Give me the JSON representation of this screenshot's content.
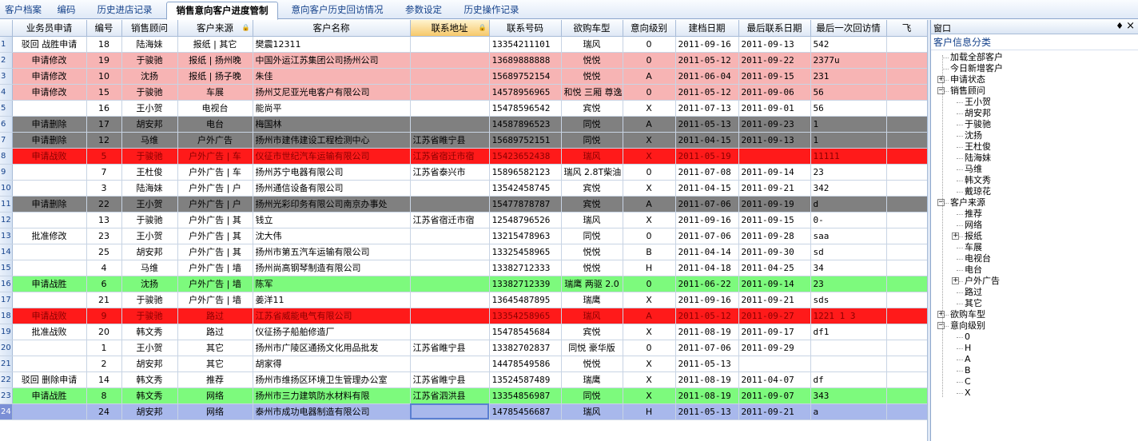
{
  "tabs": [
    "客户档案",
    "编码",
    "历史进店记录",
    "销售意向客户进度管制",
    "意向客户历史回访情况",
    "参数设定",
    "历史操作记录"
  ],
  "active_tab": 3,
  "table": {
    "headers": [
      "业务员申请",
      "编号",
      "销售顾问",
      "客户来源",
      "客户名称",
      "联系地址",
      "联系号码",
      "欲购车型",
      "意向级别",
      "建档日期",
      "最后联系日期",
      "最后一次回访情",
      "飞"
    ],
    "sorted_col": 5,
    "lock_icons": {
      "3": "lock-icon",
      "5": "lock-icon"
    },
    "rows": [
      {
        "rn": "1",
        "style": "normal",
        "cells": [
          "驳回 战胜申请",
          "18",
          "陆海妹",
          "报纸 | 其它",
          "樊震12311",
          "",
          "13354211101",
          "瑞风",
          "0",
          "2011-09-16",
          "2011-09-13",
          "542",
          ""
        ]
      },
      {
        "rn": "2",
        "style": "pink",
        "cells": [
          "申请修改",
          "19",
          "于骏驰",
          "报纸 | 扬州晚",
          "中国外运江苏集团公司扬州公司",
          "",
          "13689888888",
          "悦悦",
          "0",
          "2011-05-12",
          "2011-09-22",
          "2377u",
          ""
        ]
      },
      {
        "rn": "3",
        "style": "pink",
        "cells": [
          "申请修改",
          "10",
          "沈扬",
          "报纸 | 扬子晚",
          "朱佳",
          "",
          "15689752154",
          "悦悦",
          "A",
          "2011-06-04",
          "2011-09-15",
          "231",
          ""
        ]
      },
      {
        "rn": "4",
        "style": "pink",
        "cells": [
          "申请修改",
          "15",
          "于骏驰",
          "车展",
          "扬州艾尼亚光电客户有限公司",
          "",
          "14578956965",
          "和悦 三厢 尊逸版",
          "0",
          "2011-05-12",
          "2011-09-06",
          "56",
          ""
        ]
      },
      {
        "rn": "5",
        "style": "normal",
        "cells": [
          "",
          "16",
          "王小贺",
          "电视台",
          "能尚平",
          "",
          "15478596542",
          "宾悦",
          "X",
          "2011-07-13",
          "2011-09-01",
          "56",
          ""
        ]
      },
      {
        "rn": "6",
        "style": "gray",
        "cells": [
          "申请删除",
          "17",
          "胡安邦",
          "电台",
          "梅国林",
          "",
          "14587896523",
          "同悦",
          "A",
          "2011-05-13",
          "2011-09-23",
          "1",
          ""
        ]
      },
      {
        "rn": "7",
        "style": "gray",
        "cells": [
          "申请删除",
          "12",
          "马维",
          "户外广告",
          "扬州市建伟建设工程检测中心",
          "江苏省睢宁县",
          "15689752151",
          "同悦",
          "X",
          "2011-04-15",
          "2011-09-13",
          "1",
          ""
        ]
      },
      {
        "rn": "8",
        "style": "red",
        "cells": [
          "申请战败",
          "5",
          "于骏驰",
          "户外广告 | 车",
          "仪征市世纪汽车运输有限公司",
          "江苏省宿迁市宿",
          "15423652438",
          "瑞风",
          "X",
          "2011-05-19",
          "",
          "11111",
          ""
        ]
      },
      {
        "rn": "9",
        "style": "normal",
        "cells": [
          "",
          "7",
          "王杜俊",
          "户外广告 | 车",
          "扬州苏宁电器有限公司",
          "江苏省泰兴市",
          "15896582123",
          "瑞风 2.8T柴油",
          "0",
          "2011-07-08",
          "2011-09-14",
          "23",
          ""
        ]
      },
      {
        "rn": "10",
        "style": "normal",
        "cells": [
          "",
          "3",
          "陆海妹",
          "户外广告 | 户",
          "扬州通信设备有限公司",
          "",
          "13542458745",
          "宾悦",
          "X",
          "2011-04-15",
          "2011-09-21",
          "342",
          ""
        ]
      },
      {
        "rn": "11",
        "style": "gray",
        "cells": [
          "申请删除",
          "22",
          "王小贺",
          "户外广告 | 户",
          "扬州光彩印务有限公司南京办事处",
          "",
          "15477878787",
          "宾悦",
          "A",
          "2011-07-06",
          "2011-09-19",
          "d",
          ""
        ]
      },
      {
        "rn": "12",
        "style": "normal",
        "cells": [
          "",
          "13",
          "于骏驰",
          "户外广告 | 其",
          "钱立",
          "江苏省宿迁市宿",
          "12548796526",
          "瑞风",
          "X",
          "2011-09-16",
          "2011-09-15",
          "0-",
          ""
        ]
      },
      {
        "rn": "13",
        "style": "normal",
        "cells": [
          "批准修改",
          "23",
          "王小贺",
          "户外广告 | 其",
          "沈大伟",
          "",
          "13215478963",
          "同悦",
          "0",
          "2011-07-06",
          "2011-09-28",
          "saa",
          ""
        ]
      },
      {
        "rn": "14",
        "style": "normal",
        "cells": [
          "",
          "25",
          "胡安邦",
          "户外广告 | 其",
          "扬州市第五汽车运输有限公司",
          "",
          "13325458965",
          "悦悦",
          "B",
          "2011-04-14",
          "2011-09-30",
          "sd",
          ""
        ]
      },
      {
        "rn": "15",
        "style": "normal",
        "cells": [
          "",
          "4",
          "马维",
          "户外广告 | 墙",
          "扬州尚高钢琴制造有限公司",
          "",
          "13382712333",
          "悦悦",
          "H",
          "2011-04-18",
          "2011-04-25",
          "34",
          ""
        ]
      },
      {
        "rn": "16",
        "style": "green",
        "cells": [
          "申请战胜",
          "6",
          "沈扬",
          "户外广告 | 墙",
          "陈军",
          "",
          "13382712339",
          "瑞鹰 两驱 2.0",
          "0",
          "2011-06-22",
          "2011-09-14",
          "23",
          ""
        ]
      },
      {
        "rn": "17",
        "style": "normal",
        "cells": [
          "",
          "21",
          "于骏驰",
          "户外广告 | 墙",
          "姜洋11",
          "",
          "13645487895",
          "瑞鹰",
          "X",
          "2011-09-16",
          "2011-09-21",
          "sds",
          ""
        ]
      },
      {
        "rn": "18",
        "style": "red",
        "cells": [
          "申请战败",
          "9",
          "于骏驰",
          "路过",
          "江苏省威能电气有限公司",
          "",
          "13354258965",
          "瑞风",
          "A",
          "2011-05-12",
          "2011-09-27",
          "1221 1 3",
          ""
        ]
      },
      {
        "rn": "19",
        "style": "normal",
        "cells": [
          "批准战败",
          "20",
          "韩文秀",
          "路过",
          "仪征扬子船舶修造厂",
          "",
          "15478545684",
          "宾悦",
          "X",
          "2011-08-19",
          "2011-09-17",
          "df1",
          ""
        ]
      },
      {
        "rn": "20",
        "style": "normal",
        "cells": [
          "",
          "1",
          "王小贺",
          "其它",
          "扬州市广陵区通扬文化用品批发",
          "江苏省睢宁县",
          "13382702837",
          "同悦 豪华版",
          "0",
          "2011-07-06",
          "2011-09-29",
          "",
          ""
        ]
      },
      {
        "rn": "21",
        "style": "normal",
        "cells": [
          "",
          "2",
          "胡安邦",
          "其它",
          "胡家得",
          "",
          "14478549586",
          "悦悦",
          "X",
          "2011-05-13",
          "",
          "",
          ""
        ]
      },
      {
        "rn": "22",
        "style": "normal",
        "cells": [
          "驳回 删除申请",
          "14",
          "韩文秀",
          "推荐",
          "扬州市维扬区环境卫生管理办公室",
          "江苏省睢宁县",
          "13524587489",
          "瑞鹰",
          "X",
          "2011-08-19",
          "2011-04-07",
          "df",
          ""
        ]
      },
      {
        "rn": "23",
        "style": "green",
        "cells": [
          "申请战胜",
          "8",
          "韩文秀",
          "网络",
          "扬州市三力建筑防水材料有限",
          "江苏省泗洪县",
          "13354856987",
          "同悦",
          "X",
          "2011-08-19",
          "2011-09-07",
          "343",
          ""
        ]
      },
      {
        "rn": "24",
        "style": "blue",
        "cells": [
          "",
          "24",
          "胡安邦",
          "网络",
          "泰州市成功电器制造有限公司",
          "",
          "14785456687",
          "瑞风",
          "H",
          "2011-05-13",
          "2011-09-21",
          "a",
          ""
        ]
      }
    ]
  },
  "panel": {
    "title": "窗口",
    "pin": "♦",
    "close": "×",
    "category": "客户信息分类",
    "tree": [
      {
        "label": "加载全部客户",
        "level": 0,
        "toggle": ""
      },
      {
        "label": "今日新增客户",
        "level": 0,
        "toggle": ""
      },
      {
        "label": "申请状态",
        "level": 0,
        "toggle": "+"
      },
      {
        "label": "销售顾问",
        "level": 0,
        "toggle": "-"
      },
      {
        "label": "王小贺",
        "level": 1,
        "toggle": ""
      },
      {
        "label": "胡安邦",
        "level": 1,
        "toggle": ""
      },
      {
        "label": "于骏驰",
        "level": 1,
        "toggle": ""
      },
      {
        "label": "沈扬",
        "level": 1,
        "toggle": ""
      },
      {
        "label": "王杜俊",
        "level": 1,
        "toggle": ""
      },
      {
        "label": "陆海妹",
        "level": 1,
        "toggle": ""
      },
      {
        "label": "马维",
        "level": 1,
        "toggle": ""
      },
      {
        "label": "韩文秀",
        "level": 1,
        "toggle": ""
      },
      {
        "label": "戴琼花",
        "level": 1,
        "toggle": ""
      },
      {
        "label": "客户来源",
        "level": 0,
        "toggle": "-"
      },
      {
        "label": "推荐",
        "level": 1,
        "toggle": ""
      },
      {
        "label": "网络",
        "level": 1,
        "toggle": ""
      },
      {
        "label": "报纸",
        "level": 1,
        "toggle": "+"
      },
      {
        "label": "车展",
        "level": 1,
        "toggle": ""
      },
      {
        "label": "电视台",
        "level": 1,
        "toggle": ""
      },
      {
        "label": "电台",
        "level": 1,
        "toggle": ""
      },
      {
        "label": "户外广告",
        "level": 1,
        "toggle": "+"
      },
      {
        "label": "路过",
        "level": 1,
        "toggle": ""
      },
      {
        "label": "其它",
        "level": 1,
        "toggle": ""
      },
      {
        "label": "欲购车型",
        "level": 0,
        "toggle": "+"
      },
      {
        "label": "意向级别",
        "level": 0,
        "toggle": "-"
      },
      {
        "label": "0",
        "level": 1,
        "toggle": ""
      },
      {
        "label": "H",
        "level": 1,
        "toggle": ""
      },
      {
        "label": "A",
        "level": 1,
        "toggle": ""
      },
      {
        "label": "B",
        "level": 1,
        "toggle": ""
      },
      {
        "label": "C",
        "level": 1,
        "toggle": ""
      },
      {
        "label": "X",
        "level": 1,
        "toggle": ""
      }
    ]
  }
}
